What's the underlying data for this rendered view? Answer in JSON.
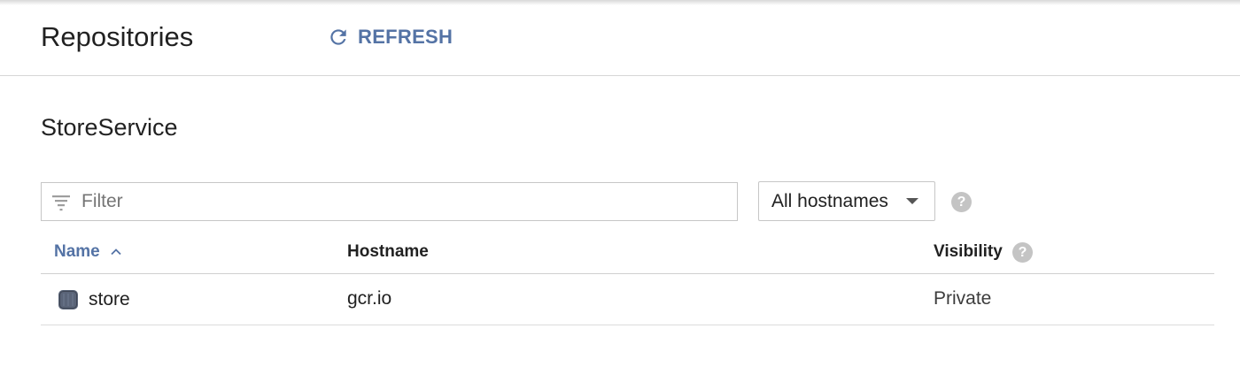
{
  "header": {
    "title": "Repositories",
    "refresh_label": "REFRESH"
  },
  "section": {
    "title": "StoreService"
  },
  "filter": {
    "placeholder": "Filter",
    "value": ""
  },
  "hostname_select": {
    "selected": "All hostnames",
    "help": "?"
  },
  "table": {
    "columns": [
      "Name",
      "Hostname",
      "Visibility"
    ],
    "sort_column": "Name",
    "sort_direction": "ascending",
    "visibility_help": "?",
    "rows": [
      {
        "name": "store",
        "hostname": "gcr.io",
        "visibility": "Private"
      }
    ]
  },
  "colors": {
    "accent": "#5473a5",
    "border": "#c6c6c6",
    "help_icon": "#c4c4c4",
    "repo_icon": "#5a6478"
  },
  "icons": {
    "refresh": "refresh-icon",
    "filter": "filter-icon",
    "dropdown": "caret-down-icon",
    "help": "help-icon",
    "sort": "chevron-up-icon",
    "repository": "repository-icon"
  }
}
